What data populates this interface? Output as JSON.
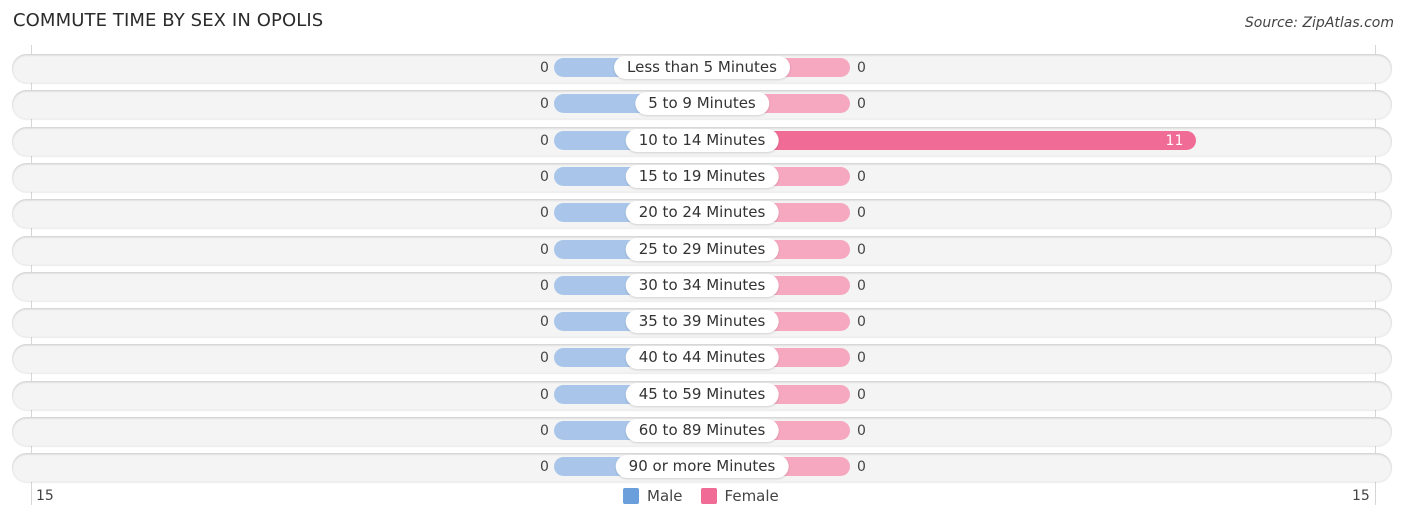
{
  "chart_data": {
    "type": "bar",
    "orientation": "horizontal-diverging",
    "title": "COMMUTE TIME BY SEX IN OPOLIS",
    "source": "Source: ZipAtlas.com",
    "categories": [
      "Less than 5 Minutes",
      "5 to 9 Minutes",
      "10 to 14 Minutes",
      "15 to 19 Minutes",
      "20 to 24 Minutes",
      "25 to 29 Minutes",
      "30 to 34 Minutes",
      "35 to 39 Minutes",
      "40 to 44 Minutes",
      "45 to 59 Minutes",
      "60 to 89 Minutes",
      "90 or more Minutes"
    ],
    "series": [
      {
        "name": "Male",
        "color": "#6a9fdc",
        "values": [
          0,
          0,
          0,
          0,
          0,
          0,
          0,
          0,
          0,
          0,
          0,
          0
        ]
      },
      {
        "name": "Female",
        "color": "#f06b95",
        "values": [
          0,
          0,
          11,
          0,
          0,
          0,
          0,
          0,
          0,
          0,
          0,
          0
        ]
      }
    ],
    "xlim": [
      -15,
      15
    ],
    "tick_labels": {
      "left": "15",
      "right": "15"
    },
    "legend_position": "bottom-center",
    "colors": {
      "male_bar": "#a9c6ea",
      "female_bar": "#f6a8c0",
      "female_bar_strong": "#f06b95",
      "row_bg": "#f4f4f4"
    }
  }
}
